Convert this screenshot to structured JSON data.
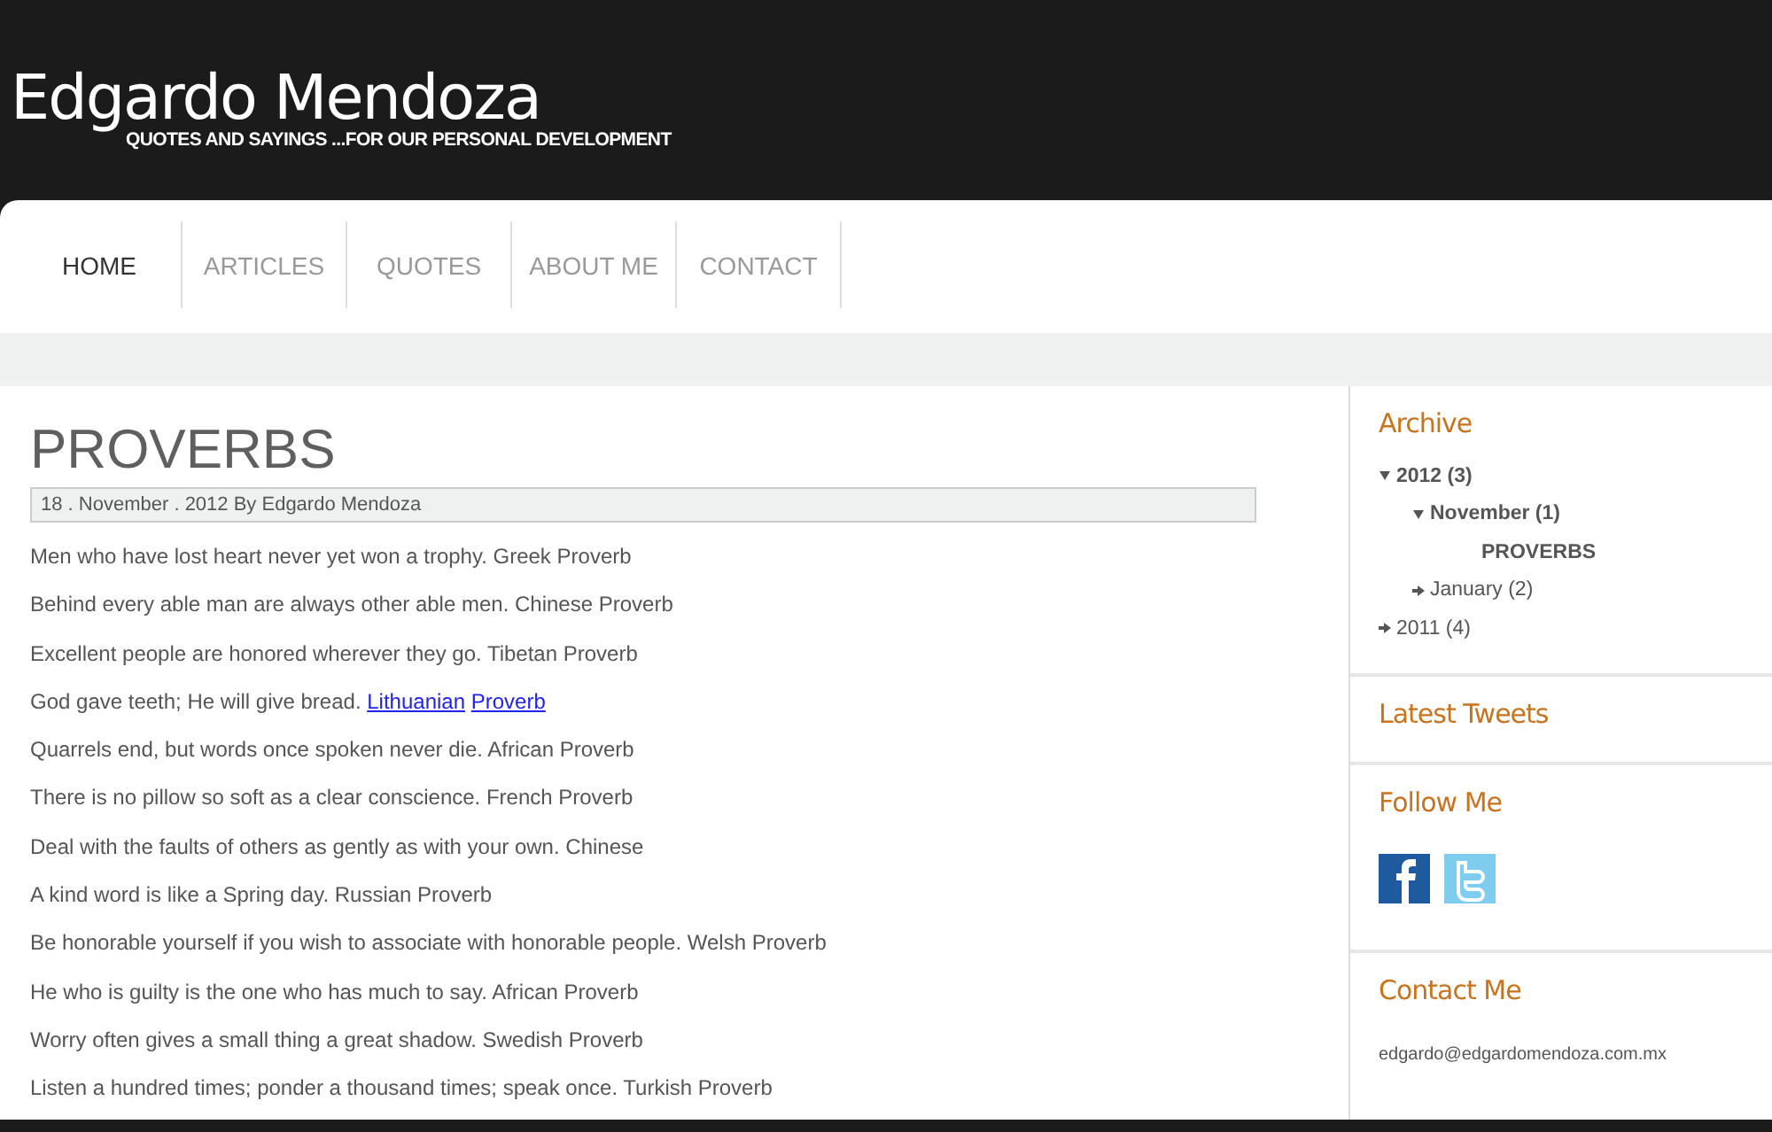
{
  "header": {
    "title": "Edgardo Mendoza",
    "tagline": "QUOTES AND SAYINGS ...FOR OUR PERSONAL DEVELOPMENT"
  },
  "nav": [
    {
      "label": "HOME",
      "selected": true
    },
    {
      "label": "ARTICLES",
      "selected": false
    },
    {
      "label": "QUOTES",
      "selected": false
    },
    {
      "label": "ABOUT ME",
      "selected": false
    },
    {
      "label": "CONTACT",
      "selected": false
    }
  ],
  "post": {
    "title": "PROVERBS",
    "meta": "18 . November . 2012  By Edgardo Mendoza",
    "quotes": [
      {
        "text": "Men who have lost heart never yet won a trophy. Greek Proverb"
      },
      {
        "text": "Behind every able man are always other able men. Chinese Proverb"
      },
      {
        "text": "Excellent people are honored wherever they go. Tibetan Proverb"
      },
      {
        "text": "God gave teeth; He will give bread.",
        "links": [
          "Lithuanian",
          "Proverb"
        ]
      },
      {
        "text": "Quarrels end, but words once spoken never die. African Proverb"
      },
      {
        "text": "There is no pillow so soft as a clear conscience. French Proverb"
      },
      {
        "text": "Deal with the faults of others as gently as with your own. Chinese"
      },
      {
        "text": "A kind word is like a Spring day. Russian Proverb"
      },
      {
        "text": "Be honorable yourself if you wish to associate with honorable people. Welsh Proverb"
      },
      {
        "text": "He who is guilty is the one who has much to say. African Proverb"
      },
      {
        "text": "Worry often gives a small thing a great shadow. Swedish Proverb"
      },
      {
        "text": "Listen a hundred times; ponder a thousand times; speak once. Turkish Proverb"
      }
    ]
  },
  "sidebar": {
    "archive": {
      "title": "Archive",
      "items": [
        {
          "label": "2012 (3)",
          "expanded": true,
          "children": [
            {
              "label": "November (1)",
              "expanded": true,
              "children": [
                {
                  "label": "PROVERBS",
                  "kind": "post"
                }
              ]
            },
            {
              "label": "January (2)",
              "expanded": false
            }
          ]
        },
        {
          "label": "2011 (4)",
          "expanded": false
        }
      ]
    },
    "tweets": {
      "title": "Latest Tweets"
    },
    "follow": {
      "title": "Follow Me",
      "icons": [
        {
          "kind": "facebook"
        },
        {
          "kind": "twitter"
        }
      ]
    },
    "contact": {
      "title": "Contact Me",
      "email": "edgardo@edgardomendoza.com.mx"
    }
  }
}
